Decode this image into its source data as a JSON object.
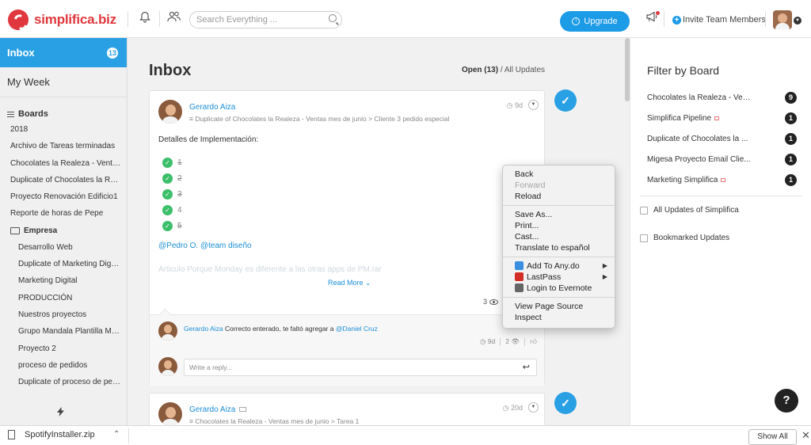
{
  "topbar": {
    "logo_text": "simplifica.biz",
    "search_placeholder": "Search Everything ...",
    "upgrade_label": "Upgrade",
    "invite_label": "Invite Team Members"
  },
  "sidebar": {
    "inbox_label": "Inbox",
    "inbox_count": "13",
    "myweek_label": "My Week",
    "boards_label": "Boards",
    "boards": [
      "2018",
      "Archivo de Tareas terminadas",
      "Chocolates la Realeza - Ventas ...",
      "Duplicate of Chocolates la Reale...",
      "Proyecto Renovación Edificio1",
      "Reporte de horas de Pepe"
    ],
    "folder_label": "Empresa",
    "folder_boards": [
      "Desarrollo Web",
      "Duplicate of Marketing Digital",
      "Marketing Digital",
      "PRODUCCIÓN",
      "Nuestros proyectos",
      "Grupo Mandala Plantilla Mens...",
      "Proyecto 2",
      "proceso de pedidos",
      "Duplicate of proceso de pedid..."
    ]
  },
  "main": {
    "title": "Inbox",
    "filter_open": "Open (13)",
    "filter_all": " / All Updates",
    "card1": {
      "author": "Gerardo Aiza",
      "crumb": "Duplicate of Chocolates la Realeza - Ventas mes de junio > Cliente 3 pedido especial",
      "time": "9d",
      "title": "Detalles de Implementación:",
      "checklist": [
        "1",
        "2",
        "3",
        "4",
        "5"
      ],
      "mentions": "@Pedro O. @team diseño",
      "faded_text": "Articulo Porque Monday es diferente a las otras apps de PM.rar",
      "read_more": "Read More",
      "views": "3",
      "reply": {
        "author": "Gerardo Aiza",
        "text": " Correcto enterado, te faltó agregar a ",
        "mention": "@Daniel Cruz",
        "time": "9d",
        "views": "2"
      },
      "reply_placeholder": "Write a reply..."
    },
    "card2": {
      "author": "Gerardo Aiza",
      "crumb": "Chocolates la Realeza - Ventas mes de junio > Tarea 1",
      "time": "20d"
    }
  },
  "rightpanel": {
    "title": "Filter by Board",
    "boards": [
      {
        "name": "Chocolates la Realeza - Ven...",
        "count": "9"
      },
      {
        "name": "Simplifica Pipeline",
        "count": "1"
      },
      {
        "name": "Duplicate of Chocolates la ...",
        "count": "1"
      },
      {
        "name": "Migesa Proyecto Email Clie...",
        "count": "1"
      },
      {
        "name": "Marketing Simplifica",
        "count": "1"
      }
    ],
    "all_updates_label": "All Updates of Simplifica",
    "bookmarked_label": "Bookmarked Updates",
    "help_label": "?"
  },
  "context_menu": {
    "back": "Back",
    "forward": "Forward",
    "reload": "Reload",
    "save_as": "Save As...",
    "print": "Print...",
    "cast": "Cast...",
    "translate": "Translate to español",
    "add_to_anydo": "Add To Any.do",
    "lastpass": "LastPass",
    "login_evernote": "Login to Evernote",
    "view_source": "View Page Source",
    "inspect": "Inspect"
  },
  "download_bar": {
    "filename": "SpotifyInstaller.zip",
    "show_all": "Show All"
  },
  "colors": {
    "brand_red": "#e0383e",
    "accent_blue": "#2aa0e4",
    "check_green": "#3cbf6a"
  }
}
